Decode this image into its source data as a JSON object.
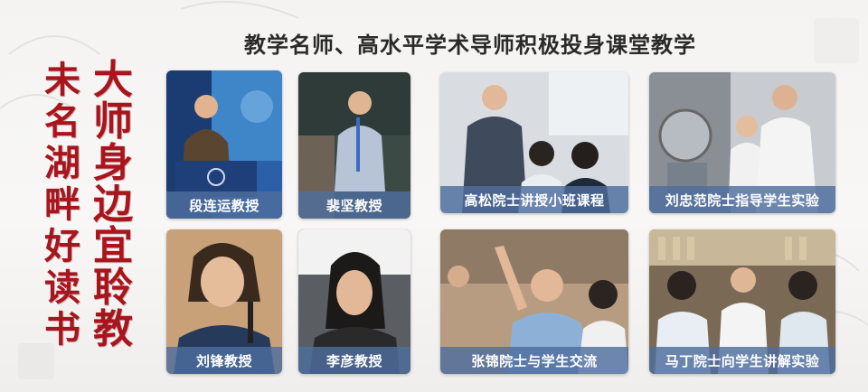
{
  "slide": {
    "heading": "教学名师、高水平学术导师积极投身课堂教学",
    "vertical_right": [
      "大",
      "师",
      "身",
      "边",
      "宜",
      "聆",
      "教"
    ],
    "vertical_left": [
      "未",
      "名",
      "湖",
      "畔",
      "好",
      "读",
      "书"
    ],
    "accent_color": "#a8151d",
    "caption_bg": "#4e6e9e"
  },
  "photos": [
    {
      "caption": "段连运教授"
    },
    {
      "caption": "裴坚教授"
    },
    {
      "caption": "高松院士讲授小班课程"
    },
    {
      "caption": "刘忠范院士指导学生实验"
    },
    {
      "caption": "刘锋教授"
    },
    {
      "caption": "李彦教授"
    },
    {
      "caption": "张锦院士与学生交流"
    },
    {
      "caption": "马丁院士向学生讲解实验"
    }
  ]
}
